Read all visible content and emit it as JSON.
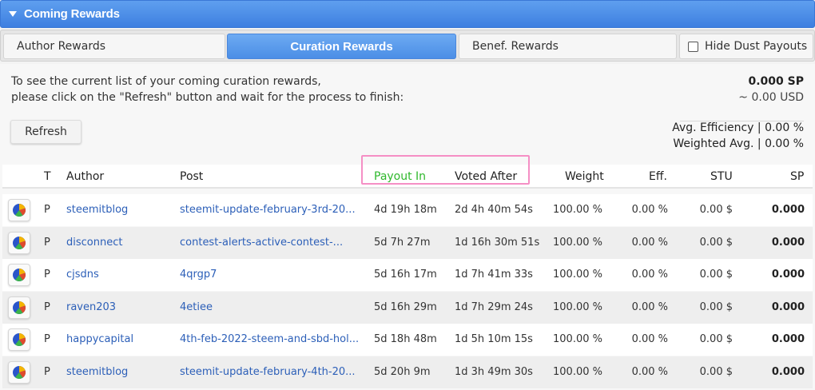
{
  "header": {
    "title": "Coming Rewards"
  },
  "tabs": {
    "author": "Author Rewards",
    "curation": "Curation Rewards",
    "benef": "Benef. Rewards",
    "hide_dust": "Hide Dust Payouts"
  },
  "info": {
    "line1": "To see the current list of your coming curation rewards,",
    "line2": "please click on the \"Refresh\" button and wait for the process to finish:",
    "refresh_label": "Refresh"
  },
  "totals": {
    "sp": "0.000 SP",
    "usd": "~ 0.00 USD",
    "avg_efficiency": "Avg. Efficiency | 0.00 %",
    "weighted_avg": "Weighted Avg. | 0.00 %"
  },
  "table": {
    "headers": {
      "type": "T",
      "author": "Author",
      "post": "Post",
      "payout_in": "Payout In",
      "voted_after": "Voted After",
      "weight": "Weight",
      "eff": "Eff.",
      "stu": "STU",
      "sp": "SP"
    },
    "rows": [
      {
        "type": "P",
        "author": "steemitblog",
        "post": "steemit-update-february-3rd-20...",
        "payout_in": "4d 19h 18m",
        "voted_after": "2d 4h 40m 54s",
        "weight": "100.00 %",
        "eff": "0.00 %",
        "stu": "0.00 $",
        "sp": "0.000"
      },
      {
        "type": "P",
        "author": "disconnect",
        "post": "contest-alerts-active-contest-...",
        "payout_in": "5d 7h 27m",
        "voted_after": "1d 16h 30m 51s",
        "weight": "100.00 %",
        "eff": "0.00 %",
        "stu": "0.00 $",
        "sp": "0.000"
      },
      {
        "type": "P",
        "author": "cjsdns",
        "post": "4qrgp7",
        "payout_in": "5d 16h 17m",
        "voted_after": "1d 7h 41m 33s",
        "weight": "100.00 %",
        "eff": "0.00 %",
        "stu": "0.00 $",
        "sp": "0.000"
      },
      {
        "type": "P",
        "author": "raven203",
        "post": "4etiee",
        "payout_in": "5d 16h 29m",
        "voted_after": "1d 7h 29m 24s",
        "weight": "100.00 %",
        "eff": "0.00 %",
        "stu": "0.00 $",
        "sp": "0.000"
      },
      {
        "type": "P",
        "author": "happycapital",
        "post": "4th-feb-2022-steem-and-sbd-hol...",
        "payout_in": "5d 18h 48m",
        "voted_after": "1d 5h 10m 15s",
        "weight": "100.00 %",
        "eff": "0.00 %",
        "stu": "0.00 $",
        "sp": "0.000"
      },
      {
        "type": "P",
        "author": "steemitblog",
        "post": "steemit-update-february-4th-20...",
        "payout_in": "5d 20h 9m",
        "voted_after": "1d 3h 49m 30s",
        "weight": "100.00 %",
        "eff": "0.00 %",
        "stu": "0.00 $",
        "sp": "0.000"
      }
    ]
  },
  "colors": {
    "header_blue": "#4a8ae6",
    "active_tab_blue": "#5b9cee",
    "link_blue": "#2c5fb8",
    "payout_green": "#2fb82c",
    "highlight_pink": "#f58fc5"
  },
  "icons": {
    "row_action": "pie-chart-icon",
    "header_toggle": "triangle-down-icon"
  }
}
